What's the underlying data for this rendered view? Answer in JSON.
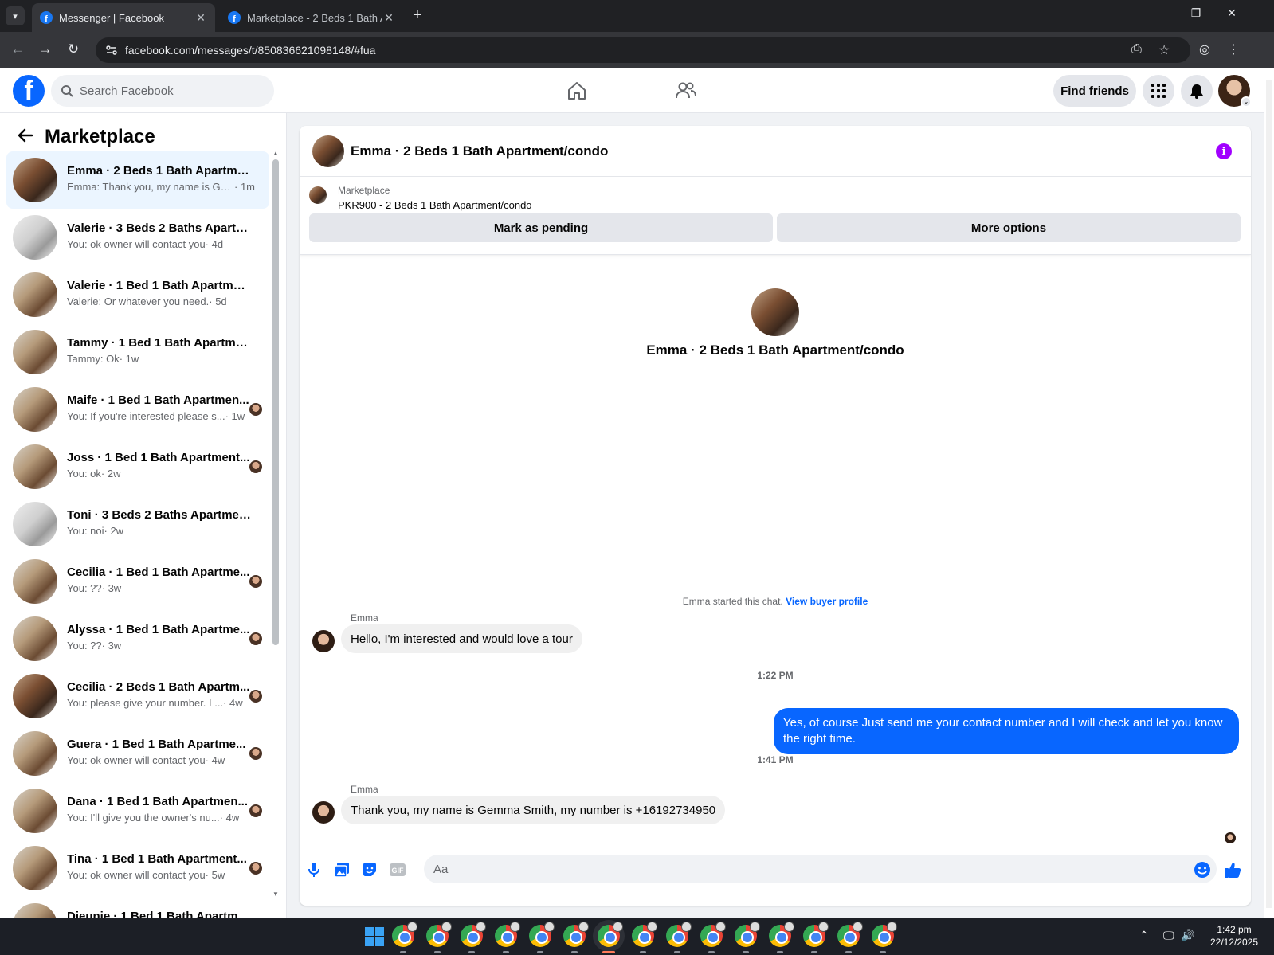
{
  "browser": {
    "tabs": [
      {
        "title": "Messenger | Facebook",
        "active": true
      },
      {
        "title": "Marketplace - 2 Beds 1 Bath Ap",
        "active": false
      }
    ],
    "url": "facebook.com/messages/t/850836621098148/#fua"
  },
  "header": {
    "search_placeholder": "Search Facebook",
    "find_friends": "Find friends"
  },
  "sidebar": {
    "title": "Marketplace",
    "conversations": [
      {
        "name": "Emma · 2 Beds 1 Bath Apartmen...",
        "message": "Emma: Thank you, my name is Ge...",
        "time": " · 1m",
        "active": true
      },
      {
        "name": "Valerie · 3 Beds 2 Baths Apartme...",
        "message": "You: ok owner will contact you",
        "time": " · 4d"
      },
      {
        "name": "Valerie · 1 Bed 1 Bath Apartment...",
        "message": "Valerie: Or whatever you need.",
        "time": " · 5d"
      },
      {
        "name": "Tammy · 1 Bed 1 Bath Apartment...",
        "message": "Tammy: Ok",
        "time": " · 1w"
      },
      {
        "name": "Maife · 1 Bed 1 Bath Apartmen...",
        "message": "You: If you're interested please s...",
        "time": " · 1w"
      },
      {
        "name": "Joss · 1 Bed 1 Bath Apartment...",
        "message": "You: ok",
        "time": " · 2w"
      },
      {
        "name": "Toni · 3 Beds 2 Baths Apartment...",
        "message": "You: noi",
        "time": " · 2w"
      },
      {
        "name": "Cecilia · 1 Bed 1 Bath Apartme...",
        "message": "You: ??",
        "time": " · 3w"
      },
      {
        "name": "Alyssa · 1 Bed 1 Bath Apartme...",
        "message": "You: ??",
        "time": " · 3w"
      },
      {
        "name": "Cecilia · 2 Beds 1 Bath Apartm...",
        "message": "You: please give your number. I ...",
        "time": " · 4w"
      },
      {
        "name": "Guera · 1 Bed 1 Bath Apartme...",
        "message": "You: ok owner will contact you",
        "time": " · 4w"
      },
      {
        "name": "Dana · 1 Bed 1 Bath Apartmen...",
        "message": "You: I'll give you the owner's nu...",
        "time": " · 4w"
      },
      {
        "name": "Tina · 1 Bed 1 Bath Apartment...",
        "message": "You: ok owner will contact you",
        "time": " · 5w"
      },
      {
        "name": "Djeunie · 1 Bed 1 Bath Apartm...",
        "message": "",
        "time": ""
      }
    ]
  },
  "chat": {
    "title": "Emma · 2 Beds 1 Bath Apartment/condo",
    "listing_source": "Marketplace",
    "listing_title": "PKR900 - 2 Beds 1 Bath Apartment/condo",
    "mark_pending": "Mark as pending",
    "more_options": "More options",
    "hero_name": "Emma · 2 Beds 1 Bath Apartment/condo",
    "started_text": "Emma started this chat.",
    "view_profile": "View buyer profile",
    "messages": [
      {
        "sender": "Emma",
        "text": "Hello, I'm interested and would love a tour"
      },
      {
        "time": "1:22 PM"
      },
      {
        "sender": "You",
        "text": "Yes, of course Just send me your contact number and I will check and let you know the right time."
      },
      {
        "time": "1:41 PM"
      },
      {
        "sender": "Emma",
        "text": "Thank you, my name is Gemma Smith, my number is +16192734950"
      }
    ],
    "composer_placeholder": "Aa"
  },
  "taskbar": {
    "time": "1:42 pm",
    "date": "22/12/2025"
  },
  "colors": {
    "fb_blue": "#0866ff",
    "info_purple": "#a100ff"
  }
}
